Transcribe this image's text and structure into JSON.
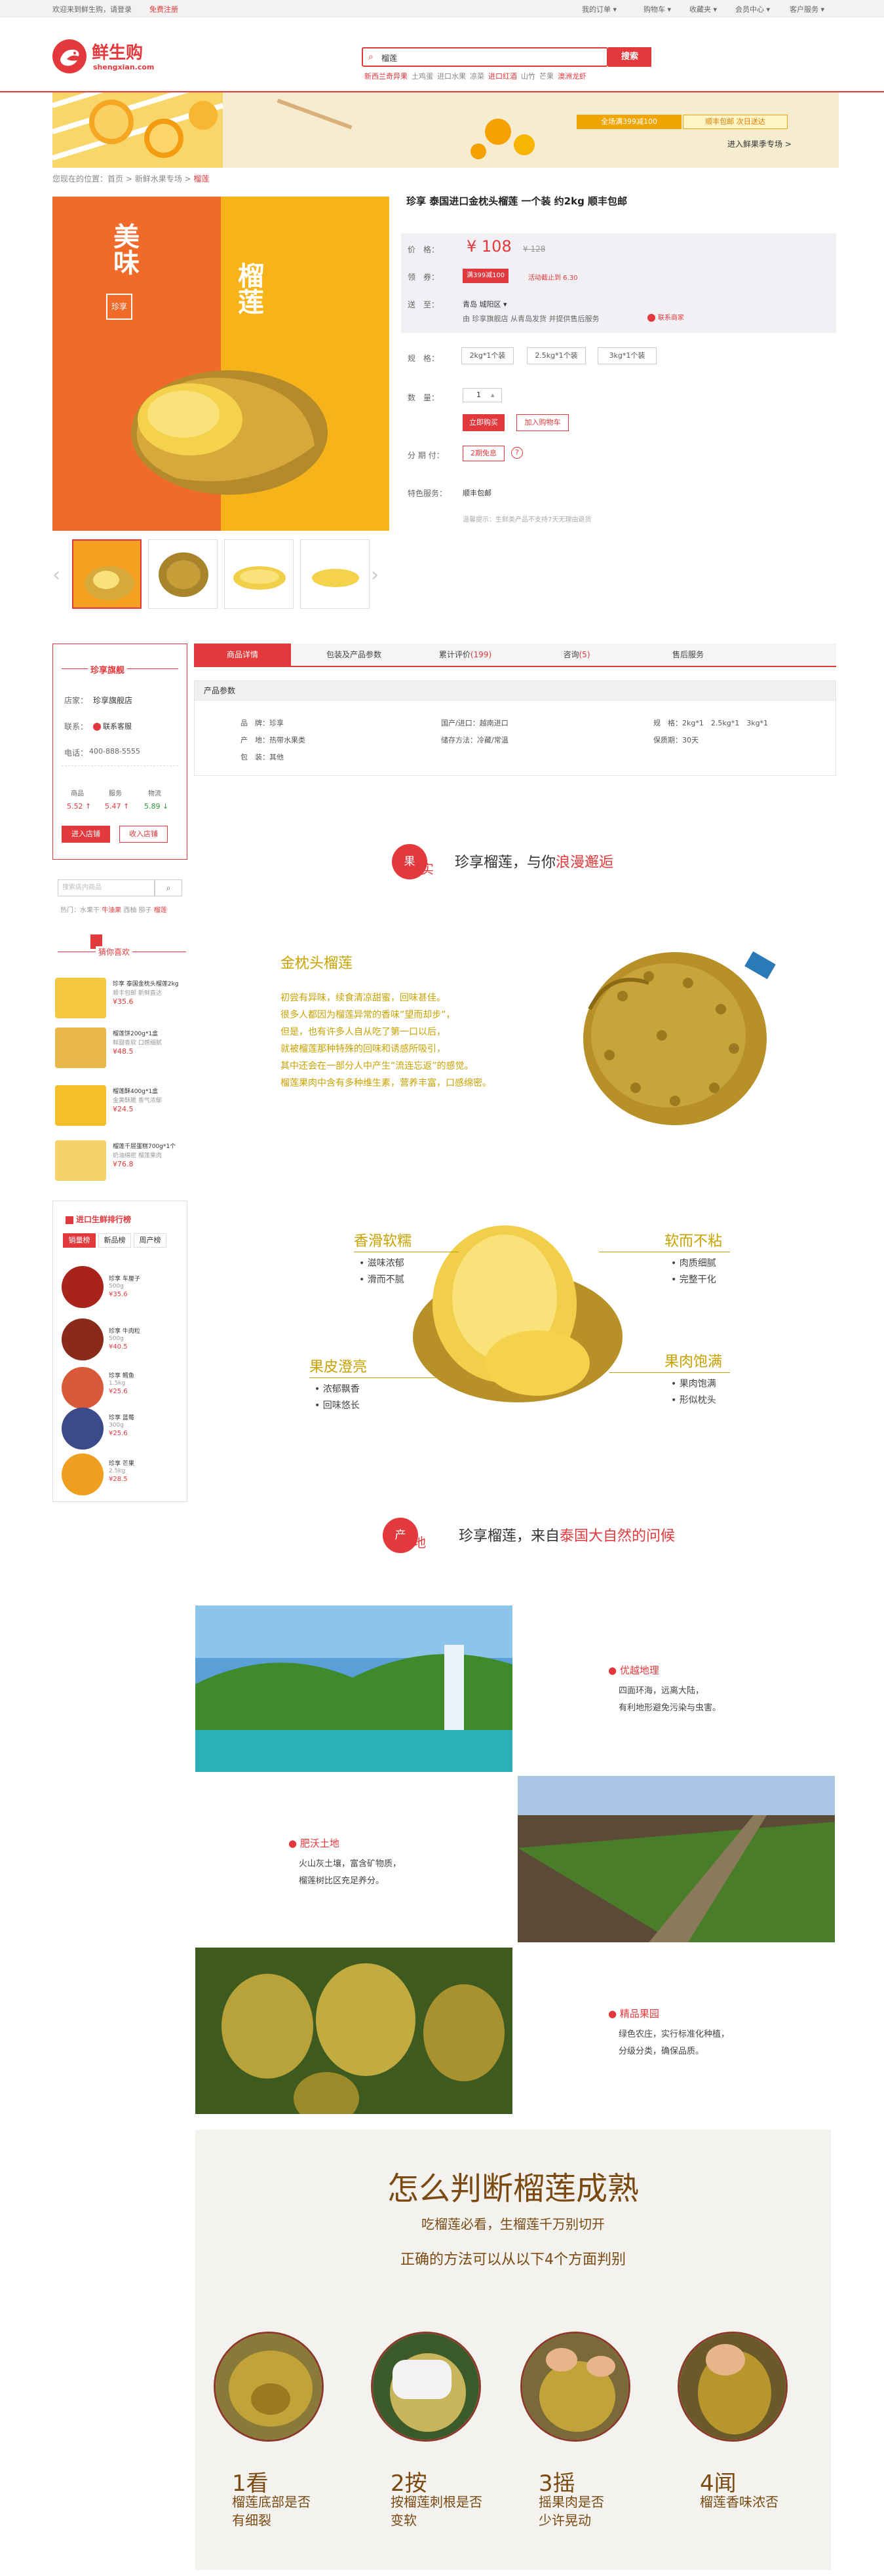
{
  "topbar": {
    "welcome": "欢迎来到鲜生购，请登录",
    "register": "免费注册",
    "my_order": "我的订单 ▾",
    "cart": "购物车 ▾",
    "favorites": "收藏夹 ▾",
    "member": "会员中心 ▾",
    "service": "客户服务 ▾"
  },
  "logo": {
    "cn": "鲜生购",
    "en": "shengxian.com"
  },
  "search": {
    "value": "榴莲",
    "button": "搜索",
    "hot": [
      "新西兰奇异果",
      "土鸡蛋",
      "进口水果",
      "凉菜",
      "进口红酒",
      "山竹",
      "芒果",
      "澳洲龙虾"
    ]
  },
  "banner": {
    "promo_full": "全场满399减100",
    "promo_ship": "顺丰包邮 次日送达",
    "link": "进入鲜果季专场 >"
  },
  "breadcrumb": {
    "prefix": "您现在的位置：",
    "home": "首页",
    "sep1": " > ",
    "cat": "新鲜水果专场",
    "sep2": " > ",
    "current": "榴莲"
  },
  "product_image": {
    "brand_top": "美味",
    "brand_right": "榴莲",
    "brand_stamp": "珍享"
  },
  "product": {
    "title": "珍享 泰国进口金枕头榴莲 一个装 约2kg 顺丰包邮",
    "price_label": "价　格：",
    "price": "¥ 108",
    "old_price": "¥ 128",
    "coupon_label": "领　券：",
    "coupon": "满399减100",
    "coupon_note": "活动截止到 6.30",
    "ship_label": "送　至：",
    "ship_to": "青岛 城阳区 ▾",
    "ship_note": "由 珍享旗舰店 从青岛发货 并提供售后服务",
    "contact": "联系商家",
    "spec_label": "规　格：",
    "specs": [
      "2kg*1个装",
      "2.5kg*1个装",
      "3kg*1个装"
    ],
    "qty_label": "数　量：",
    "qty": "1",
    "buy_now": "立即购买",
    "add_cart": "加入购物车",
    "install_label": "分 期 付：",
    "install": "2期免息",
    "service_label": "特色服务：",
    "service": "顺丰包邮",
    "notice": "温馨提示：生鲜类产品不支持7天无理由退货"
  },
  "shop": {
    "title": "珍享旗舰",
    "shop_label": "店家：",
    "shop_name": "珍享旗舰店",
    "contact_label": "联系：",
    "contact": "联系客服",
    "phone_label": "电话：",
    "phone": "400-888-5555",
    "score_heads": [
      "商品",
      "服务",
      "物流"
    ],
    "scores": [
      "5.52 ↑",
      "5.47 ↑",
      "5.89 ↓"
    ],
    "enter": "进入店铺",
    "fav": "收入店铺"
  },
  "side_search": {
    "placeholder": "搜索店内商品",
    "hot_label": "热门：",
    "hot": [
      "水果干",
      "牛油果",
      "西柚",
      "猕子",
      "榴莲"
    ]
  },
  "guess": {
    "title": "猜你喜欢",
    "items": [
      {
        "name": "珍享 泰国金枕头榴莲2kg",
        "sub": "顺丰包邮 新鲜直达",
        "price": "¥35.6"
      },
      {
        "name": "榴莲饼200g*1盒",
        "sub": "鲜甜香软 口感细腻",
        "price": "¥48.5"
      },
      {
        "name": "榴莲酥400g*1盒",
        "sub": "金黄酥脆 香气浓郁",
        "price": "¥24.5"
      },
      {
        "name": "榴莲千层蛋糕700g*1个",
        "sub": "奶油绵密 榴莲果肉",
        "price": "¥76.8"
      }
    ]
  },
  "rank": {
    "title": "进口生鲜排行榜",
    "tabs": [
      "销量榜",
      "新品榜",
      "周产榜"
    ],
    "items": [
      {
        "name": "珍享 车厘子",
        "sub": "500g",
        "price": "¥35.6"
      },
      {
        "name": "珍享 牛肉粒",
        "sub": "500g",
        "price": "¥40.5"
      },
      {
        "name": "珍享 鳕鱼",
        "sub": "1.5kg",
        "price": "¥25.6"
      },
      {
        "name": "珍享 蓝莓",
        "sub": "300g",
        "price": "¥25.6"
      },
      {
        "name": "珍享 芒果",
        "sub": "2.5kg",
        "price": "¥28.5"
      }
    ]
  },
  "tabs": [
    "商品详情",
    "包装及产品参数",
    "累计评价",
    "(199)",
    "咨询",
    "(5)",
    "售后服务"
  ],
  "params": {
    "title": "产品参数",
    "rows": [
      [
        "品　牌：珍享",
        "国产/进口：越南进口",
        "规　格：2kg*1　2.5kg*1　3kg*1"
      ],
      [
        "产　地：热带水果类",
        "储存方法：冷藏/常温",
        "保质期：30天"
      ],
      [
        "包　装：其他",
        "",
        ""
      ]
    ]
  },
  "sec1": {
    "seal1": "果",
    "seal2": "实",
    "title_a": "珍享榴莲，与你",
    "title_b": "浪漫邂逅"
  },
  "jz": {
    "title": "金枕头榴莲",
    "lines": [
      "初尝有异味，续食清凉甜蜜，回味甚佳。",
      "很多人都因为榴莲异常的香味”望而却步”，",
      "但是，也有许多人自从吃了第一口以后，",
      "就被榴莲那种特殊的回味和诱感所吸引，",
      "其中还会在一部分人中产生”流连忘返”的感觉。",
      "榴莲果肉中含有多种维生素，营养丰富，口感绵密。"
    ]
  },
  "feats": [
    {
      "title": "香滑软糯",
      "items": [
        "• 滋味浓郁",
        "• 滑而不腻"
      ]
    },
    {
      "title": "软而不粘",
      "items": [
        "• 肉质细腻",
        "• 完整干化"
      ]
    },
    {
      "title": "果皮澄亮",
      "items": [
        "• 浓郁飘香",
        "• 回味悠长"
      ]
    },
    {
      "title": "果肉饱满",
      "items": [
        "• 果肉饱满",
        "• 形似枕头"
      ]
    }
  ],
  "sec2": {
    "seal1": "产",
    "seal2": "地",
    "title_a": "珍享榴莲，来自",
    "title_b": "泰国大自然的问候"
  },
  "origins": [
    {
      "title": "● 优越地理",
      "lines": [
        "四面环海，远离大陆，",
        "有利地形避免污染与虫害。"
      ]
    },
    {
      "title": "● 肥沃土地",
      "lines": [
        "火山灰土壤，富含矿物质，",
        "榴莲树比区充足养分。"
      ]
    },
    {
      "title": "● 精品果园",
      "lines": [
        "绿色农庄，实行标准化种植，",
        "分级分类，确保品质。"
      ]
    }
  ],
  "judge": {
    "title": "怎么判断榴莲成熟",
    "sub": "吃榴莲必看，生榴莲千万别切开",
    "sub2": "正确的方法可以从以下4个方面判别",
    "steps": [
      {
        "num": "1看",
        "t1": "榴莲底部是否",
        "t2": "有细裂"
      },
      {
        "num": "2按",
        "t1": "按榴莲刺根是否",
        "t2": "变软"
      },
      {
        "num": "3摇",
        "t1": "摇果肉是否",
        "t2": "少许晃动"
      },
      {
        "num": "4闻",
        "t1": "榴莲香味浓否",
        "t2": ""
      }
    ]
  }
}
